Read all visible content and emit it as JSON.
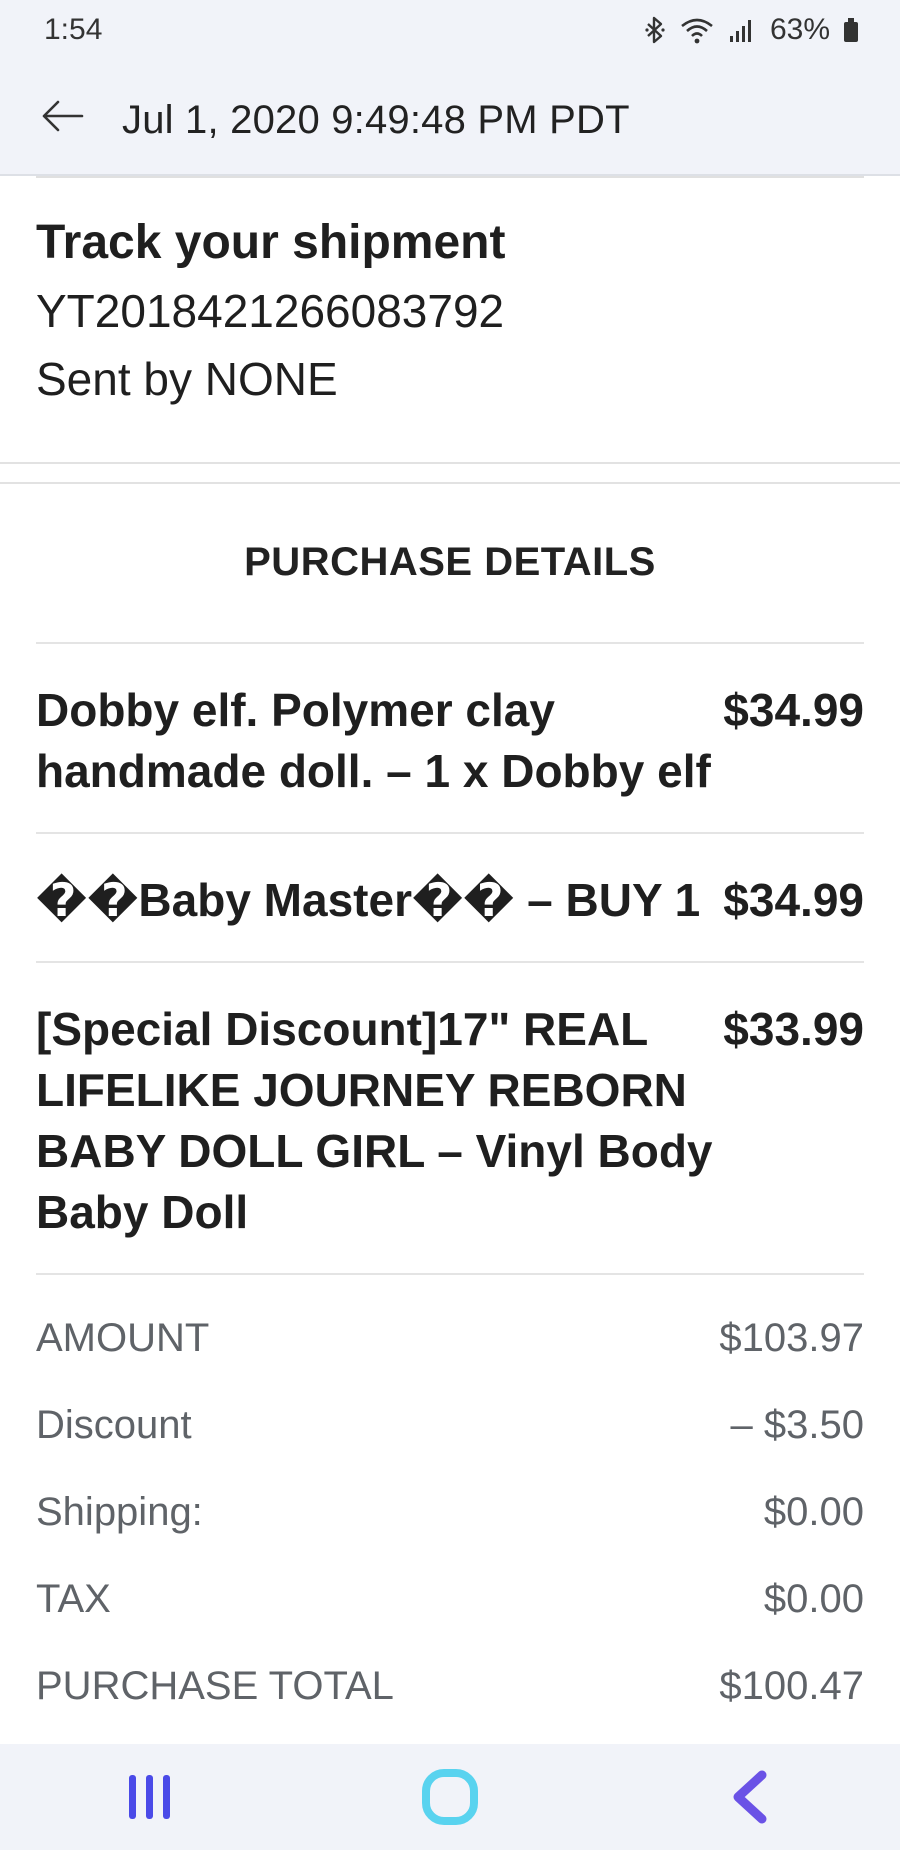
{
  "status_bar": {
    "time": "1:54",
    "battery_percent": "63%",
    "icons": [
      "bluetooth-icon",
      "wifi-icon",
      "signal-icon",
      "battery-icon"
    ]
  },
  "header": {
    "title": "Jul 1, 2020 9:49:48 PM PDT"
  },
  "tracking": {
    "title": "Track your shipment",
    "number": "YT2018421266083792",
    "sent_by": "Sent by NONE"
  },
  "purchase": {
    "heading": "PURCHASE DETAILS",
    "items": [
      {
        "name": "Dobby elf. Polymer clay handmade doll. – 1 x Dobby elf",
        "price": "$34.99"
      },
      {
        "name": "��Baby Master�� – BUY 1",
        "price": "$34.99"
      },
      {
        "name": "[Special Discount]17\" REAL LIFELIKE JOURNEY REBORN BABY DOLL GIRL – Vinyl Body Baby Doll",
        "price": "$33.99"
      }
    ],
    "summary": [
      {
        "label": "AMOUNT",
        "value": "$103.97"
      },
      {
        "label": "Discount",
        "value": "– $3.50"
      },
      {
        "label": "Shipping:",
        "value": "$0.00"
      },
      {
        "label": "TAX",
        "value": "$0.00"
      },
      {
        "label": "PURCHASE TOTAL",
        "value": "$100.47"
      }
    ]
  },
  "nav_bar": {
    "buttons": [
      "recent-apps-icon",
      "home-icon",
      "back-icon"
    ],
    "colors": {
      "recent": "#4a4ae8",
      "home": "#59d3ef",
      "back": "#6a52e6"
    }
  }
}
